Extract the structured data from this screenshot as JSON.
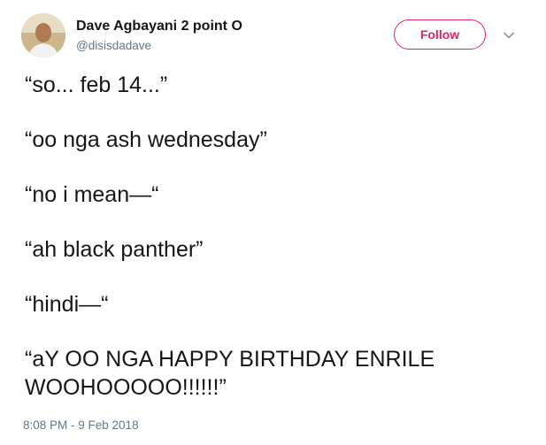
{
  "author": {
    "display_name": "Dave Agbayani 2 point O",
    "handle": "@disisdadave"
  },
  "actions": {
    "follow_label": "Follow"
  },
  "tweet": {
    "lines": [
      "“so... feb 14...”",
      "“oo nga ash wednesday”",
      "“no i mean—“",
      "“ah black panther”",
      "“hindi—“",
      "“aY OO NGA HAPPY BIRTHDAY ENRILE WOOHOOOOO!!!!!!”"
    ],
    "timestamp": "8:08 PM - 9 Feb 2018"
  },
  "icons": {
    "menu": "chevron-down-icon",
    "avatar": "avatar"
  },
  "colors": {
    "follow_accent": "#e0245e",
    "secondary_text": "#657786",
    "primary_text": "#14171a"
  }
}
